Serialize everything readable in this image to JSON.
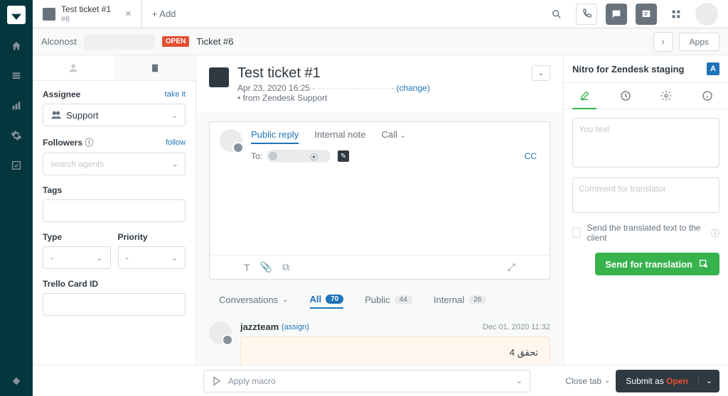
{
  "tab": {
    "title": "Test ticket #1",
    "sub": "#6",
    "add": "+ Add"
  },
  "crumb": {
    "org": "Alconost",
    "badge": "OPEN",
    "ticket": "Ticket #6",
    "apps": "Apps"
  },
  "left": {
    "assignee_label": "Assignee",
    "take_it": "take it",
    "assignee_value": "Support",
    "followers_label": "Followers",
    "follow": "follow",
    "followers_placeholder": "search agents",
    "tags_label": "Tags",
    "type_label": "Type",
    "type_value": "-",
    "priority_label": "Priority",
    "priority_value": "-",
    "trello_label": "Trello Card ID"
  },
  "ticket": {
    "title": "Test ticket #1",
    "date": "Apr 23, 2020 16:25",
    "change": "(change)",
    "via": "• from Zendesk Support"
  },
  "compose": {
    "tab_public": "Public reply",
    "tab_internal": "Internal note",
    "tab_call": "Call",
    "to_label": "To:",
    "cc": "CC"
  },
  "conv": {
    "label": "Conversations",
    "all": "All",
    "all_n": "70",
    "pub": "Public",
    "pub_n": "44",
    "int": "Internal",
    "int_n": "26"
  },
  "msg": {
    "name": "jazzteam",
    "assign": "(assign)",
    "time": "Dec 01, 2020 11:32",
    "body": "تحقق 4"
  },
  "right": {
    "title": "Nitro for Zendesk staging",
    "ph1": "You text",
    "ph2": "Comment for translator",
    "check": "Send the translated text to the client",
    "btn": "Send for translation"
  },
  "bottom": {
    "macro": "Apply macro",
    "close": "Close tab",
    "submit_pre": "Submit as ",
    "submit_status": "Open"
  }
}
